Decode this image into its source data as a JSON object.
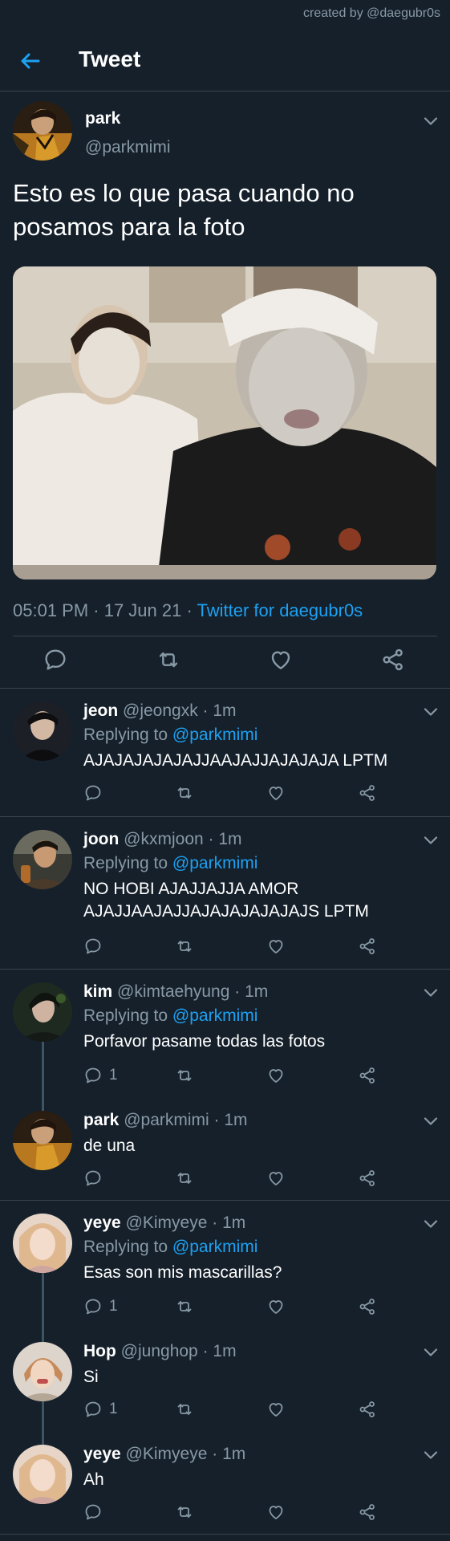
{
  "credit": "created by @daegubr0s",
  "header": {
    "title": "Tweet"
  },
  "main_tweet": {
    "name": "park",
    "handle": "@parkmimi",
    "text": "Esto es lo que pasa cuando no posamos para la foto",
    "meta": "05:01 PM · 17 Jun 21 · ",
    "source": "Twitter for daegubr0s"
  },
  "replies": [
    {
      "name": "jeon",
      "handle": "@jeongxk · 1m",
      "replying_label": "Replying to ",
      "mention": "@parkmimi",
      "text": "AJAJAJAJAJAJJAAJAJJAJAJAJA LPTM",
      "reply_count": ""
    },
    {
      "name": "joon",
      "handle": "@kxmjoon · 1m",
      "replying_label": "Replying to ",
      "mention": "@parkmimi",
      "text": "NO HOBI AJAJJAJJA AMOR AJAJJAAJAJJAJAJAJAJAJAJS LPTM",
      "reply_count": ""
    },
    {
      "name": "kim",
      "handle": "@kimtaehyung · 1m",
      "replying_label": "Replying to ",
      "mention": "@parkmimi",
      "text": "Porfavor pasame todas las fotos",
      "reply_count": "1"
    },
    {
      "name": "park",
      "handle": "@parkmimi · 1m",
      "text": "de una",
      "reply_count": ""
    },
    {
      "name": "yeye",
      "handle": "@Kimyeye · 1m",
      "replying_label": "Replying to ",
      "mention": "@parkmimi",
      "text": "Esas son mis mascarillas?",
      "reply_count": "1"
    },
    {
      "name": "Hop",
      "handle": "@junghop · 1m",
      "text": "Si",
      "reply_count": "1"
    },
    {
      "name": "yeye",
      "handle": "@Kimyeye · 1m",
      "text": "Ah",
      "reply_count": ""
    }
  ],
  "icons": {
    "back": "arrow-left-icon",
    "caret": "chevron-down-icon",
    "reply": "reply-icon",
    "retweet": "retweet-icon",
    "like": "heart-icon",
    "share": "share-icon"
  },
  "colors": {
    "background": "#15202b",
    "accent": "#1da1f2",
    "muted": "#8899a6",
    "divider": "#38444d"
  }
}
